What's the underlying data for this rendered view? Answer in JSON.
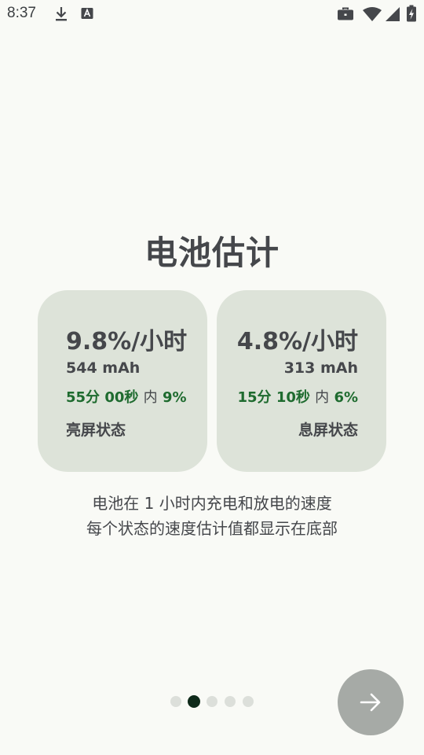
{
  "status_bar": {
    "time": "8:37",
    "icons": [
      "download-icon",
      "text-a-icon",
      "briefcase-icon",
      "wifi-icon",
      "signal-icon",
      "battery-charging-icon"
    ]
  },
  "page": {
    "title": "电池估计",
    "description_line1": "电池在 1 小时内充电和放电的速度",
    "description_line2": "每个状态的速度估计值都显示在底部"
  },
  "cards": {
    "screen_on": {
      "rate": "9.8%/小时",
      "mah": "544 mAh",
      "duration": "55分 00秒",
      "within": "内",
      "percent": "9%",
      "state": "亮屏状态"
    },
    "screen_off": {
      "rate": "4.8%/小时",
      "mah": "313 mAh",
      "duration": "15分 10秒",
      "within": "内",
      "percent": "6%",
      "state": "息屏状态"
    }
  },
  "pager": {
    "total": 5,
    "active_index": 1
  },
  "next_button": {
    "icon": "arrow-right-icon"
  },
  "colors": {
    "background": "#f9faf6",
    "card": "#dde3d9",
    "accent_green": "#1e6b2f",
    "text": "#45474b",
    "button": "#a6aaa6",
    "dot_active": "#0f2a1a",
    "dot_inactive": "#dcdfda"
  }
}
